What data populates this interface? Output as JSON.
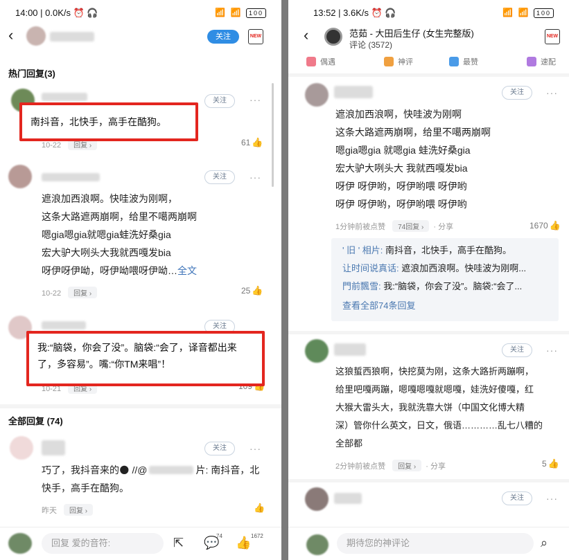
{
  "left": {
    "status": {
      "time": "14:00 | 0.0K/s ⏰ 🎧",
      "icons": "📶 📶 ",
      "battery": "100"
    },
    "header": {
      "follow_label": "关注",
      "new_label": "NEW"
    },
    "hot_section": "热门回复(3)",
    "hot": [
      {
        "text": "南抖音，北快手，高手在酷狗。",
        "date": "10-22",
        "reply": "回复 ›",
        "likes": "61"
      },
      {
        "lines": [
          "遮浪加西浪啊。快哇波为刚啊，",
          "这条大路遮两崩啊，给里不噶两崩啊",
          "嗯gia嗯gia就嗯gia蛙洗好桑gia",
          "宏大驴大咧头大我就西嘎发bia",
          "呀伊呀伊呦，呀伊呦喂呀伊呦…"
        ],
        "more": "全文",
        "date": "10-22",
        "reply": "回复 ›",
        "likes": "25"
      },
      {
        "text": "我:“脑袋，你会了没”。脑袋:“会了，译音都出来了，多容易”。嘴:“你TM来唱”！",
        "date": "10-21",
        "reply": "回复 ›",
        "likes": "109"
      }
    ],
    "all_section": "全部回复 (74)",
    "all": [
      {
        "line1": "巧了，我抖音来的🌑 //@",
        "line1b": "片: 南抖音，北",
        "line2": "快手，高手在酷狗。",
        "date": "昨天",
        "reply": "回复 ›"
      }
    ],
    "bottom": {
      "placeholder": "回复 爱的音符:",
      "comment_count": "74",
      "like_count": "1672"
    }
  },
  "right": {
    "status": {
      "time": "13:52 | 3.6K/s ⏰ 🎧",
      "icons": "📶 📶 ",
      "battery": "100"
    },
    "header": {
      "title": "范茹 - 大田后生仔 (女生完整版)",
      "subtitle": "评论 (3572)",
      "new_label": "NEW"
    },
    "tabs": [
      {
        "label": "偶遇",
        "color": "#f07a8a"
      },
      {
        "label": "神评",
        "color": "#f0a040"
      },
      {
        "label": "最赞",
        "color": "#4a9be8"
      },
      {
        "label": "速配",
        "color": "#b07ae0"
      }
    ],
    "comments": [
      {
        "follow": "关注",
        "lines": [
          "遮浪加西浪啊，快哇波为刚啊",
          "这条大路遮两崩啊，给里不噶两崩啊",
          "嗯gia嗯gia 就嗯gia 蛙洗好桑gia",
          "宏大驴大咧头大 我就西嘎发bia",
          "呀伊 呀伊哟，呀伊哟喂 呀伊哟",
          "呀伊 呀伊哟，呀伊哟喂 呀伊哟"
        ],
        "time": "1分钟前被点赞",
        "reply": "74回复 ›",
        "share": "· 分享",
        "likes": "1670",
        "quotes": [
          {
            "name": "' 旧 ' 相片:",
            "text": " 南抖音，北快手，高手在酷狗。"
          },
          {
            "name": "让时间说真话:",
            "text": " 遮浪加西浪啊。快哇波为刚啊..."
          },
          {
            "name": "門前飄雪:",
            "text": " 我:“脑袋，你会了没”。脑袋:“会了..."
          }
        ],
        "view_all": "查看全部74条回复"
      },
      {
        "follow": "关注",
        "lines": [
          "这狼蜇西狼啊，快挖莫为刚，这条大路折两蹦啊，",
          "给里吧嘎两蹦，嗯嘎嗯嘎就嗯嘎，娃洗好傻嘎，红",
          "大猴大雷头大，我就洗靠大饼（中国文化博大精",
          "深）管你什么英文，日文，俄语…………乱七八糟的",
          "全部都"
        ],
        "time": "2分钟前被点赞",
        "reply": "回复 ›",
        "share": "· 分享",
        "likes": "5"
      },
      {
        "follow": "关注"
      }
    ],
    "bottom": {
      "placeholder": "期待您的神评论"
    }
  }
}
